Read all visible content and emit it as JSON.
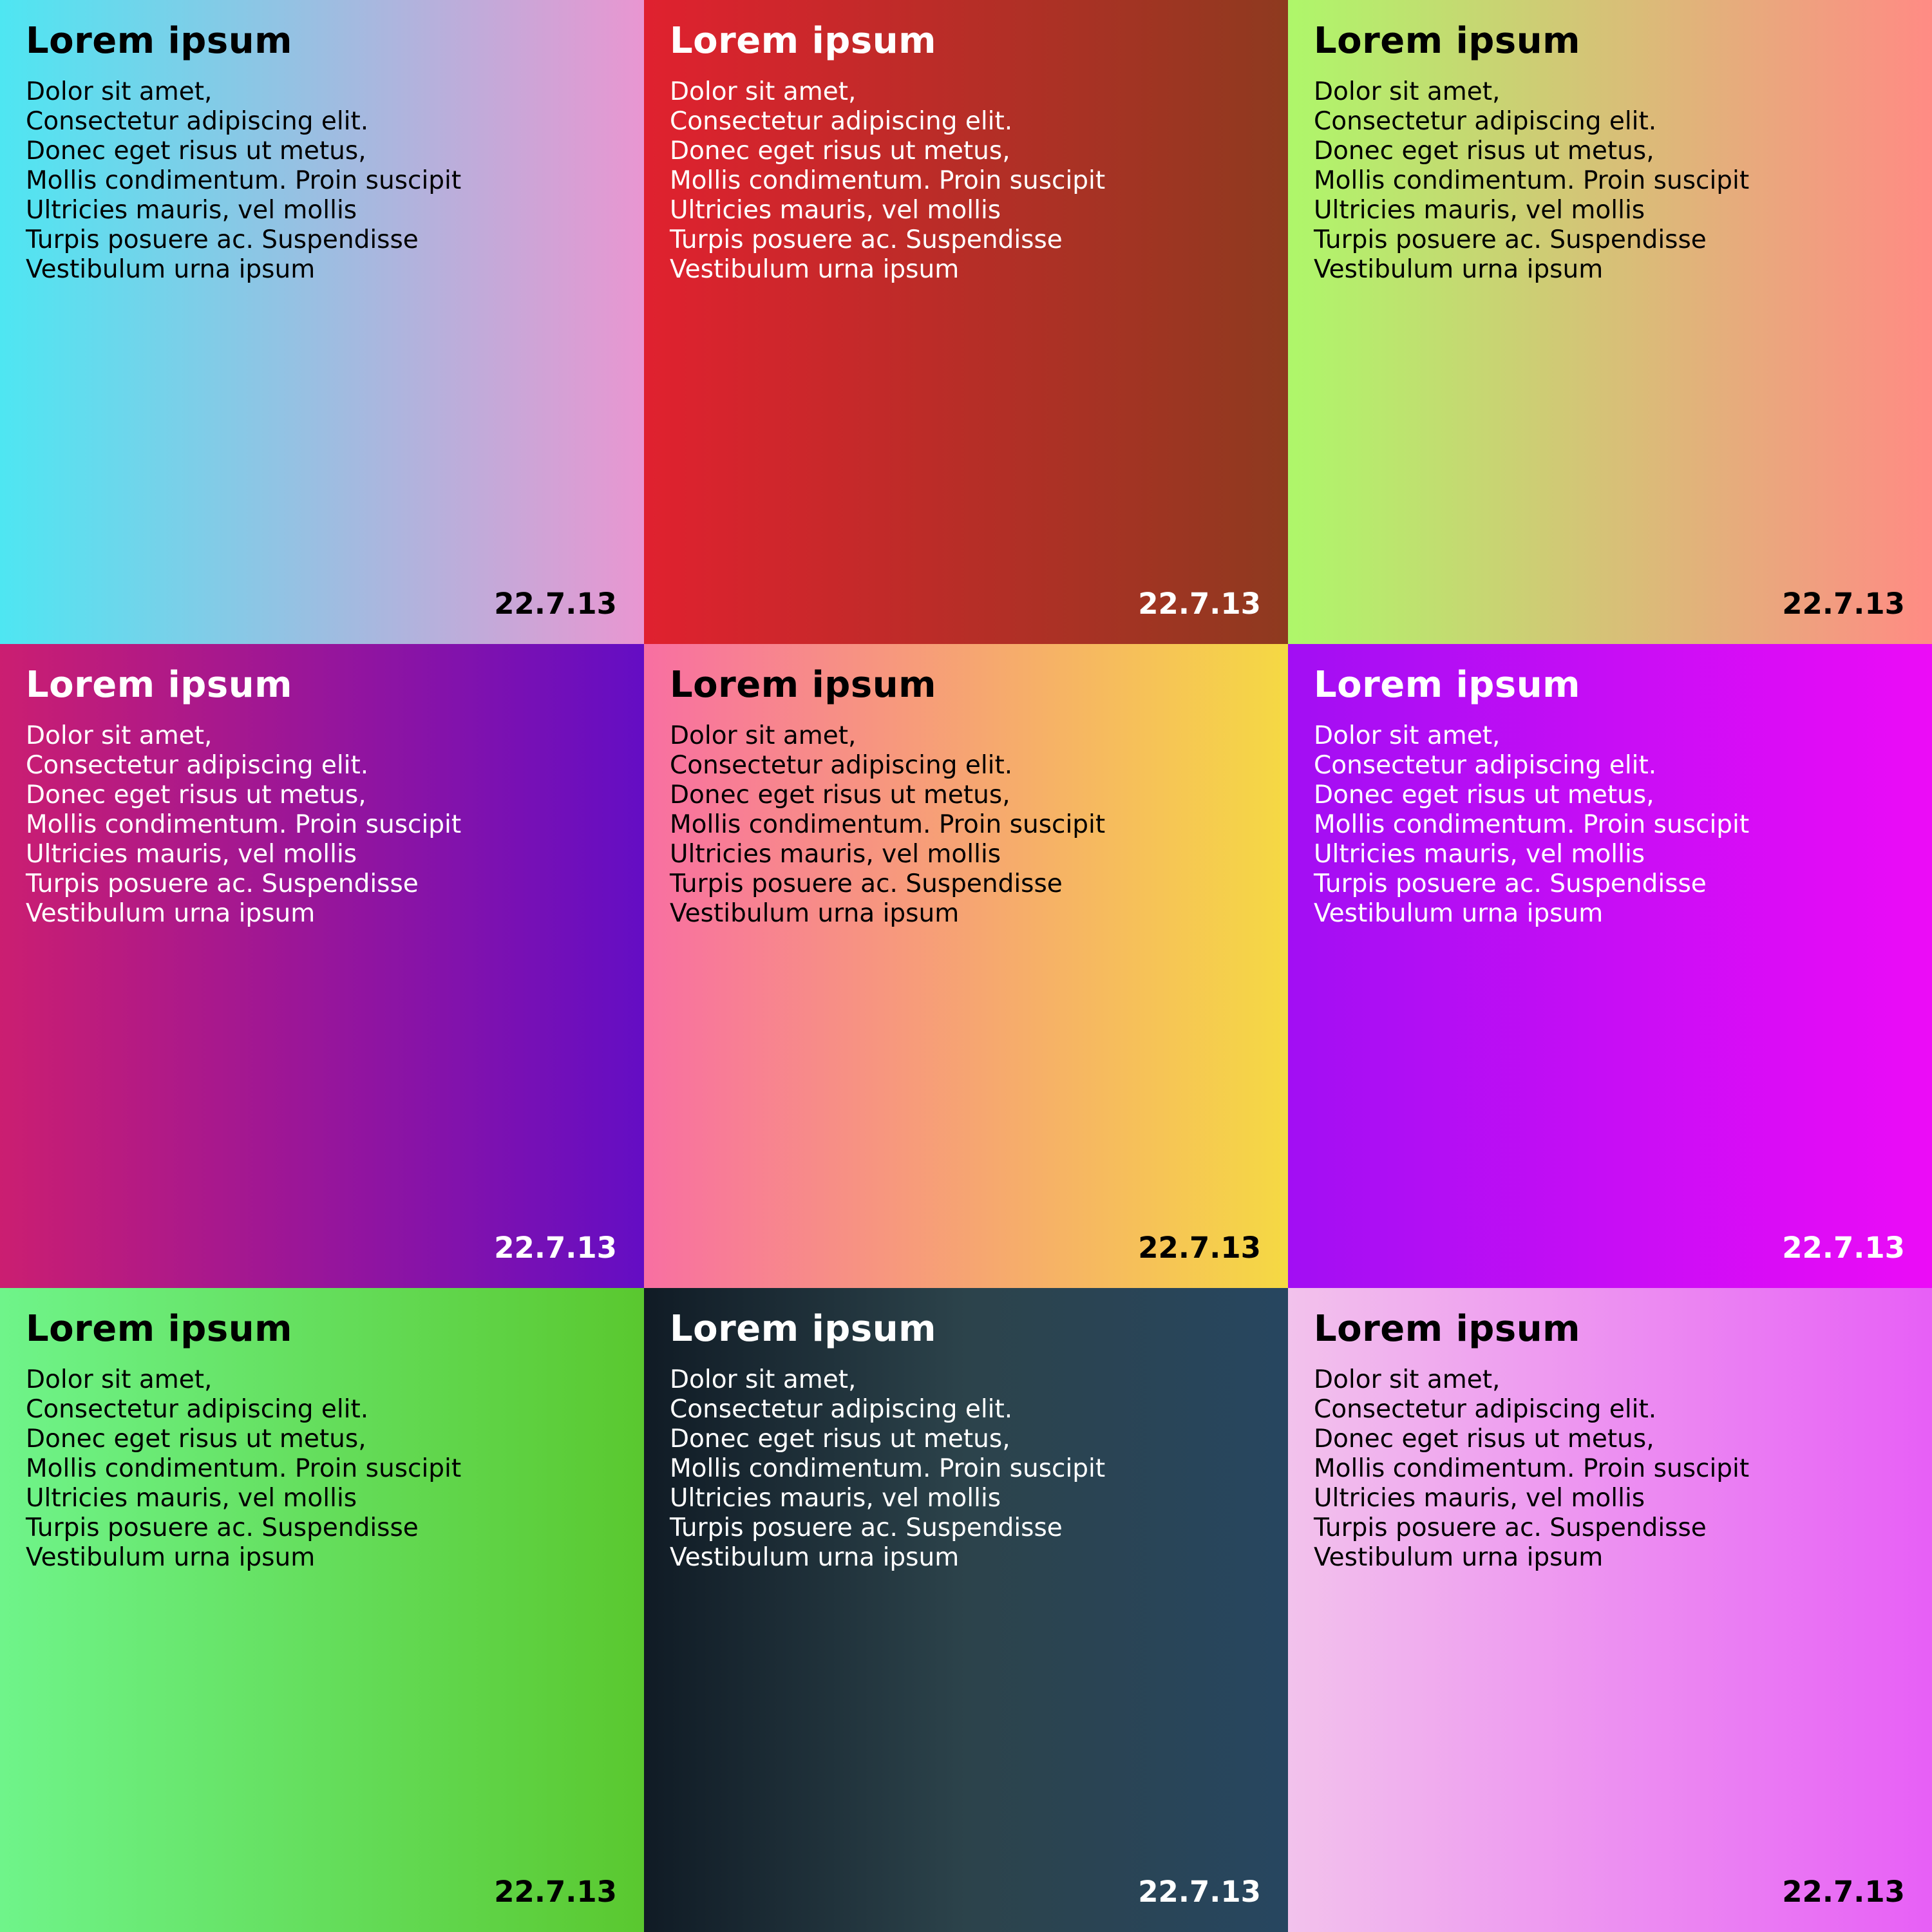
{
  "tiles": [
    {
      "title": "Lorem ipsum",
      "lines": [
        "Dolor sit amet,",
        "Consectetur adipiscing elit.",
        "Donec eget risus ut metus,",
        "Mollis condimentum. Proin suscipit",
        "Ultricies mauris, vel mollis",
        "Turpis posuere ac. Suspendisse",
        "Vestibulum urna ipsum"
      ],
      "date": "22.7.13",
      "gradient_start": "#4ee6f2",
      "gradient_end": "#e996d1",
      "text_color": "#000000"
    },
    {
      "title": "Lorem ipsum",
      "lines": [
        "Dolor sit amet,",
        "Consectetur adipiscing elit.",
        "Donec eget risus ut metus,",
        "Mollis condimentum. Proin suscipit",
        "Ultricies mauris, vel mollis",
        "Turpis posuere ac. Suspendisse",
        "Vestibulum urna ipsum"
      ],
      "date": "22.7.13",
      "gradient_start": "#e0212f",
      "gradient_end": "#8e3a1f",
      "text_color": "#ffffff"
    },
    {
      "title": "Lorem ipsum",
      "lines": [
        "Dolor sit amet,",
        "Consectetur adipiscing elit.",
        "Donec eget risus ut metus,",
        "Mollis condimentum. Proin suscipit",
        "Ultricies mauris, vel mollis",
        "Turpis posuere ac. Suspendisse",
        "Vestibulum urna ipsum"
      ],
      "date": "22.7.13",
      "gradient_start": "#aef76a",
      "gradient_end": "#ff8b84",
      "text_color": "#000000"
    },
    {
      "title": "Lorem ipsum",
      "lines": [
        "Dolor sit amet,",
        "Consectetur adipiscing elit.",
        "Donec eget risus ut metus,",
        "Mollis condimentum. Proin suscipit",
        "Ultricies mauris, vel mollis",
        "Turpis posuere ac. Suspendisse",
        "Vestibulum urna ipsum"
      ],
      "date": "22.7.13",
      "gradient_start": "#cb1e71",
      "gradient_end": "#640dc4",
      "text_color": "#ffffff"
    },
    {
      "title": "Lorem ipsum",
      "lines": [
        "Dolor sit amet,",
        "Consectetur adipiscing elit.",
        "Donec eget risus ut metus,",
        "Mollis condimentum. Proin suscipit",
        "Ultricies mauris, vel mollis",
        "Turpis posuere ac. Suspendisse",
        "Vestibulum urna ipsum"
      ],
      "date": "22.7.13",
      "gradient_start": "#f86fa2",
      "gradient_end": "#f5d943",
      "text_color": "#000000"
    },
    {
      "title": "Lorem ipsum",
      "lines": [
        "Dolor sit amet,",
        "Consectetur adipiscing elit.",
        "Donec eget risus ut metus,",
        "Mollis condimentum. Proin suscipit",
        "Ultricies mauris, vel mollis",
        "Turpis posuere ac. Suspendisse",
        "Vestibulum urna ipsum"
      ],
      "date": "22.7.13",
      "gradient_start": "#a20ef3",
      "gradient_end": "#ec0cf7",
      "text_color": "#ffffff"
    },
    {
      "title": "Lorem ipsum",
      "lines": [
        "Dolor sit amet,",
        "Consectetur adipiscing elit.",
        "Donec eget risus ut metus,",
        "Mollis condimentum. Proin suscipit",
        "Ultricies mauris, vel mollis",
        "Turpis posuere ac. Suspendisse",
        "Vestibulum urna ipsum"
      ],
      "date": "22.7.13",
      "gradient_start": "#6ff48a",
      "gradient_end": "#5ac82f",
      "text_color": "#000000"
    },
    {
      "title": "Lorem ipsum",
      "lines": [
        "Dolor sit amet,",
        "Consectetur adipiscing elit.",
        "Donec eget risus ut metus,",
        "Mollis condimentum. Proin suscipit",
        "Ultricies mauris, vel mollis",
        "Turpis posuere ac. Suspendisse",
        "Vestibulum urna ipsum"
      ],
      "date": "22.7.13",
      "gradient_start": "#101b25",
      "gradient_mid": "#2c434b",
      "gradient_end": "#274660",
      "text_color": "#ffffff"
    },
    {
      "title": "Lorem ipsum",
      "lines": [
        "Dolor sit amet,",
        "Consectetur adipiscing elit.",
        "Donec eget risus ut metus,",
        "Mollis condimentum. Proin suscipit",
        "Ultricies mauris, vel mollis",
        "Turpis posuere ac. Suspendisse",
        "Vestibulum urna ipsum"
      ],
      "date": "22.7.13",
      "gradient_start": "#f2c2ec",
      "gradient_end": "#e75ff6",
      "text_color": "#000000"
    }
  ]
}
